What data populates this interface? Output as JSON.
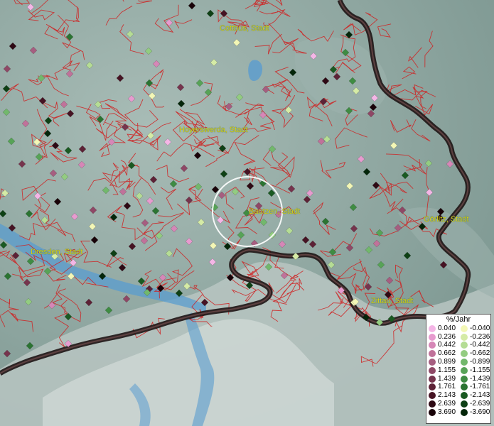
{
  "map": {
    "cities": [
      {
        "id": "cottbus",
        "name": "Cottbus, Stadt"
      },
      {
        "id": "hoyerswerda",
        "name": "Hoyerswerda, Stadt"
      },
      {
        "id": "bautzen",
        "name": "Bautzen, Stadt"
      },
      {
        "id": "goerlitz",
        "name": "Görlitz, Stadt"
      },
      {
        "id": "dresden",
        "name": "Dresden, Stadt"
      },
      {
        "id": "zittau",
        "name": "Zittau, Stadt"
      }
    ],
    "colors": {
      "boundary_lines": "#d02020",
      "national_border": "#1e1414",
      "city_label": "#d6d21a",
      "terrain": "#8fa9a4",
      "water": "#5a9ccf",
      "selection_circle": "#ffffff"
    }
  },
  "legend": {
    "title": "%/Jahr",
    "positive": [
      {
        "value": "0.040",
        "color": "#f4b6e6"
      },
      {
        "value": "0.236",
        "color": "#e79bcf"
      },
      {
        "value": "0.442",
        "color": "#d687b7"
      },
      {
        "value": "0.662",
        "color": "#c0729a"
      },
      {
        "value": "0.899",
        "color": "#a65e80"
      },
      {
        "value": "1.155",
        "color": "#8f4866"
      },
      {
        "value": "1.439",
        "color": "#76344d"
      },
      {
        "value": "1.761",
        "color": "#5d2236"
      },
      {
        "value": "2.143",
        "color": "#461323"
      },
      {
        "value": "2.639",
        "color": "#2e0914"
      },
      {
        "value": "3.690",
        "color": "#180208"
      }
    ],
    "negative": [
      {
        "value": "-0.040",
        "color": "#f3f7b6"
      },
      {
        "value": "-0.236",
        "color": "#d5eba6"
      },
      {
        "value": "-0.442",
        "color": "#b5dd95"
      },
      {
        "value": "-0.662",
        "color": "#93cc81"
      },
      {
        "value": "-0.899",
        "color": "#72b86c"
      },
      {
        "value": "-1.155",
        "color": "#57a357"
      },
      {
        "value": "-1.439",
        "color": "#3f8c43"
      },
      {
        "value": "-1.761",
        "color": "#2b7432"
      },
      {
        "value": "-2.143",
        "color": "#1a5a22"
      },
      {
        "value": "-2.639",
        "color": "#0e4015"
      },
      {
        "value": "-3.690",
        "color": "#04260a"
      }
    ]
  }
}
